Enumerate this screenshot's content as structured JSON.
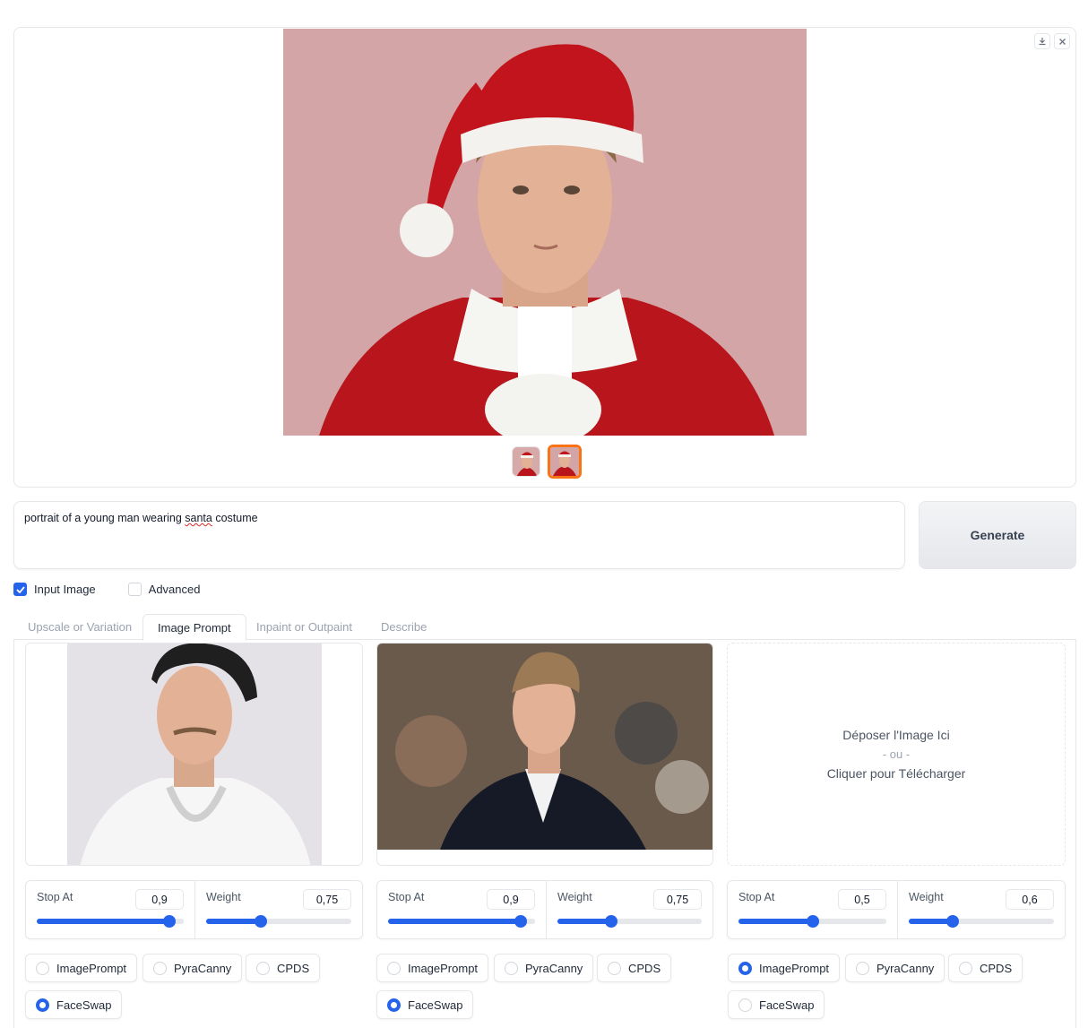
{
  "gallery": {
    "download_icon": "download-icon",
    "close_icon": "close-icon",
    "thumbnail_count": 2,
    "selected_thumbnail": 2
  },
  "prompt": {
    "text_before": "portrait of a young man wearing ",
    "misspelled_word": "santa",
    "text_after": " costume"
  },
  "generate_label": "Generate",
  "checkboxes": [
    {
      "label": "Input Image",
      "checked": true
    },
    {
      "label": "Advanced",
      "checked": false
    }
  ],
  "tabs": [
    "Upscale or Variation",
    "Image Prompt",
    "Inpaint or Outpaint",
    "Describe"
  ],
  "active_tab": "Image Prompt",
  "dropzone": {
    "line1": "Déposer l'Image Ici",
    "line2": "- ou -",
    "line3": "Cliquer pour Télécharger"
  },
  "image_prompts": [
    {
      "stop_at_label": "Stop At",
      "stop_at": "0,9",
      "stop_at_fraction": 0.9,
      "weight_label": "Weight",
      "weight": "0,75",
      "weight_fraction": 0.375,
      "options": [
        "ImagePrompt",
        "PyraCanny",
        "CPDS",
        "FaceSwap"
      ],
      "selected": "FaceSwap"
    },
    {
      "stop_at_label": "Stop At",
      "stop_at": "0,9",
      "stop_at_fraction": 0.9,
      "weight_label": "Weight",
      "weight": "0,75",
      "weight_fraction": 0.375,
      "options": [
        "ImagePrompt",
        "PyraCanny",
        "CPDS",
        "FaceSwap"
      ],
      "selected": "FaceSwap"
    },
    {
      "stop_at_label": "Stop At",
      "stop_at": "0,5",
      "stop_at_fraction": 0.5,
      "weight_label": "Weight",
      "weight": "0,6",
      "weight_fraction": 0.3,
      "options": [
        "ImagePrompt",
        "PyraCanny",
        "CPDS",
        "FaceSwap"
      ],
      "selected": "ImagePrompt"
    }
  ]
}
